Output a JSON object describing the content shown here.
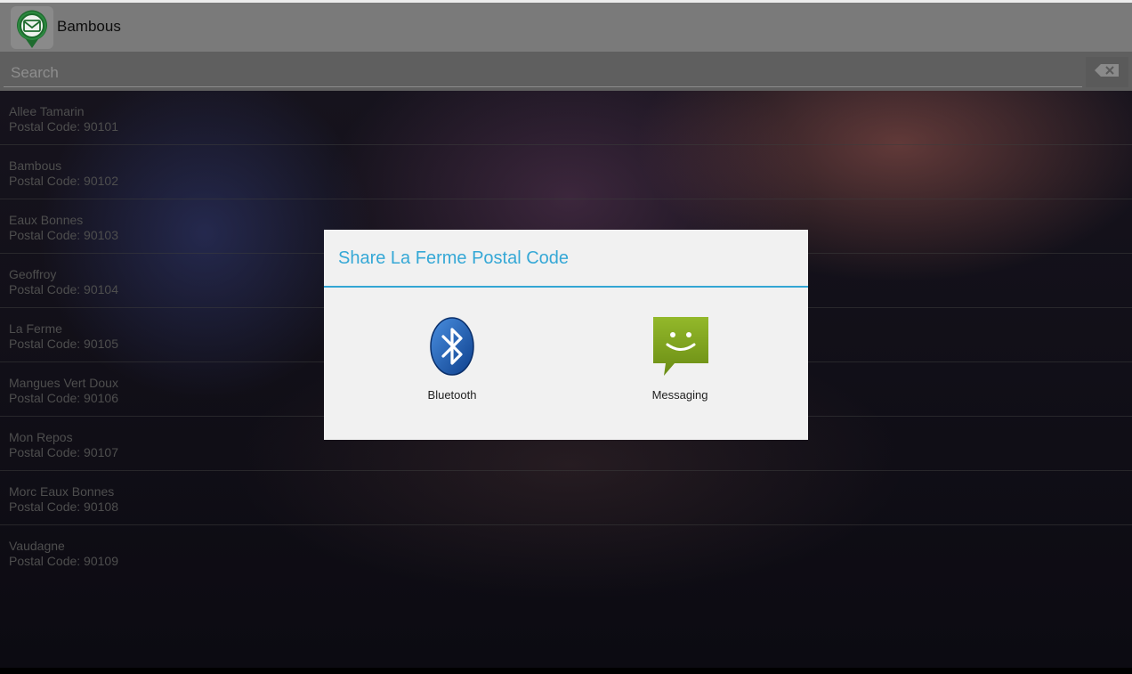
{
  "app": {
    "title": "Bambous",
    "icon": "mail-pin-icon"
  },
  "search": {
    "placeholder": "Search",
    "value": "",
    "clear_icon": "backspace-icon"
  },
  "list": [
    {
      "name": "Allee Tamarin",
      "code": "Postal Code: 90101"
    },
    {
      "name": "Bambous",
      "code": "Postal Code: 90102"
    },
    {
      "name": "Eaux Bonnes",
      "code": "Postal Code: 90103"
    },
    {
      "name": "Geoffroy",
      "code": "Postal Code: 90104"
    },
    {
      "name": "La Ferme",
      "code": "Postal Code: 90105"
    },
    {
      "name": "Mangues Vert Doux",
      "code": "Postal Code: 90106"
    },
    {
      "name": "Mon Repos",
      "code": "Postal Code: 90107"
    },
    {
      "name": "Morc Eaux Bonnes",
      "code": "Postal Code: 90108"
    },
    {
      "name": "Vaudagne",
      "code": "Postal Code: 90109"
    }
  ],
  "dialog": {
    "title": "Share La Ferme Postal Code",
    "options": [
      {
        "label": "Bluetooth",
        "icon": "bluetooth-icon"
      },
      {
        "label": "Messaging",
        "icon": "messaging-icon"
      }
    ]
  },
  "colors": {
    "accent": "#33b5e5",
    "bluetooth": "#1b5fb3",
    "messaging": "#7ea11b"
  }
}
